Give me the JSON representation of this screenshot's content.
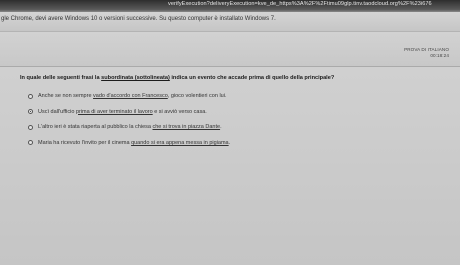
{
  "browser": {
    "url": "verifyExecution?deliveryExecution=kve_de_https%3A%2F%2Ftimu09glp.tinv.taodcloud.org%2F%23i676"
  },
  "banner": {
    "message": "gle Chrome, devi avere Windows 10 o versioni successive. Su questo computer è installato Windows 7."
  },
  "exam": {
    "label": "PROVA DI ITALIANO",
    "timer": "00:18:24"
  },
  "question": {
    "before": "In quale delle seguenti frasi la ",
    "underlined": "subordinata (sottolineata)",
    "after": " indica un evento che accade prima di quello della principale?"
  },
  "options": [
    {
      "prefix": "Anche se non sempre ",
      "underlined": "vado d'accordo con Francesco",
      "suffix": ", gioco volentieri con lui.",
      "selected": false
    },
    {
      "prefix": "Uscì dall'ufficio ",
      "underlined": "prima di aver terminato il lavoro",
      "suffix": " e si avviò verso casa.",
      "selected": true
    },
    {
      "prefix": "L'altro ieri è stata riaperta al pubblico la chiesa ",
      "underlined": "che si trova in piazza Dante",
      "suffix": ".",
      "selected": false
    },
    {
      "prefix": "Maria ha ricevuto l'invito per il cinema ",
      "underlined": "quando si era appena messa in pigiama",
      "suffix": ".",
      "selected": false
    }
  ]
}
